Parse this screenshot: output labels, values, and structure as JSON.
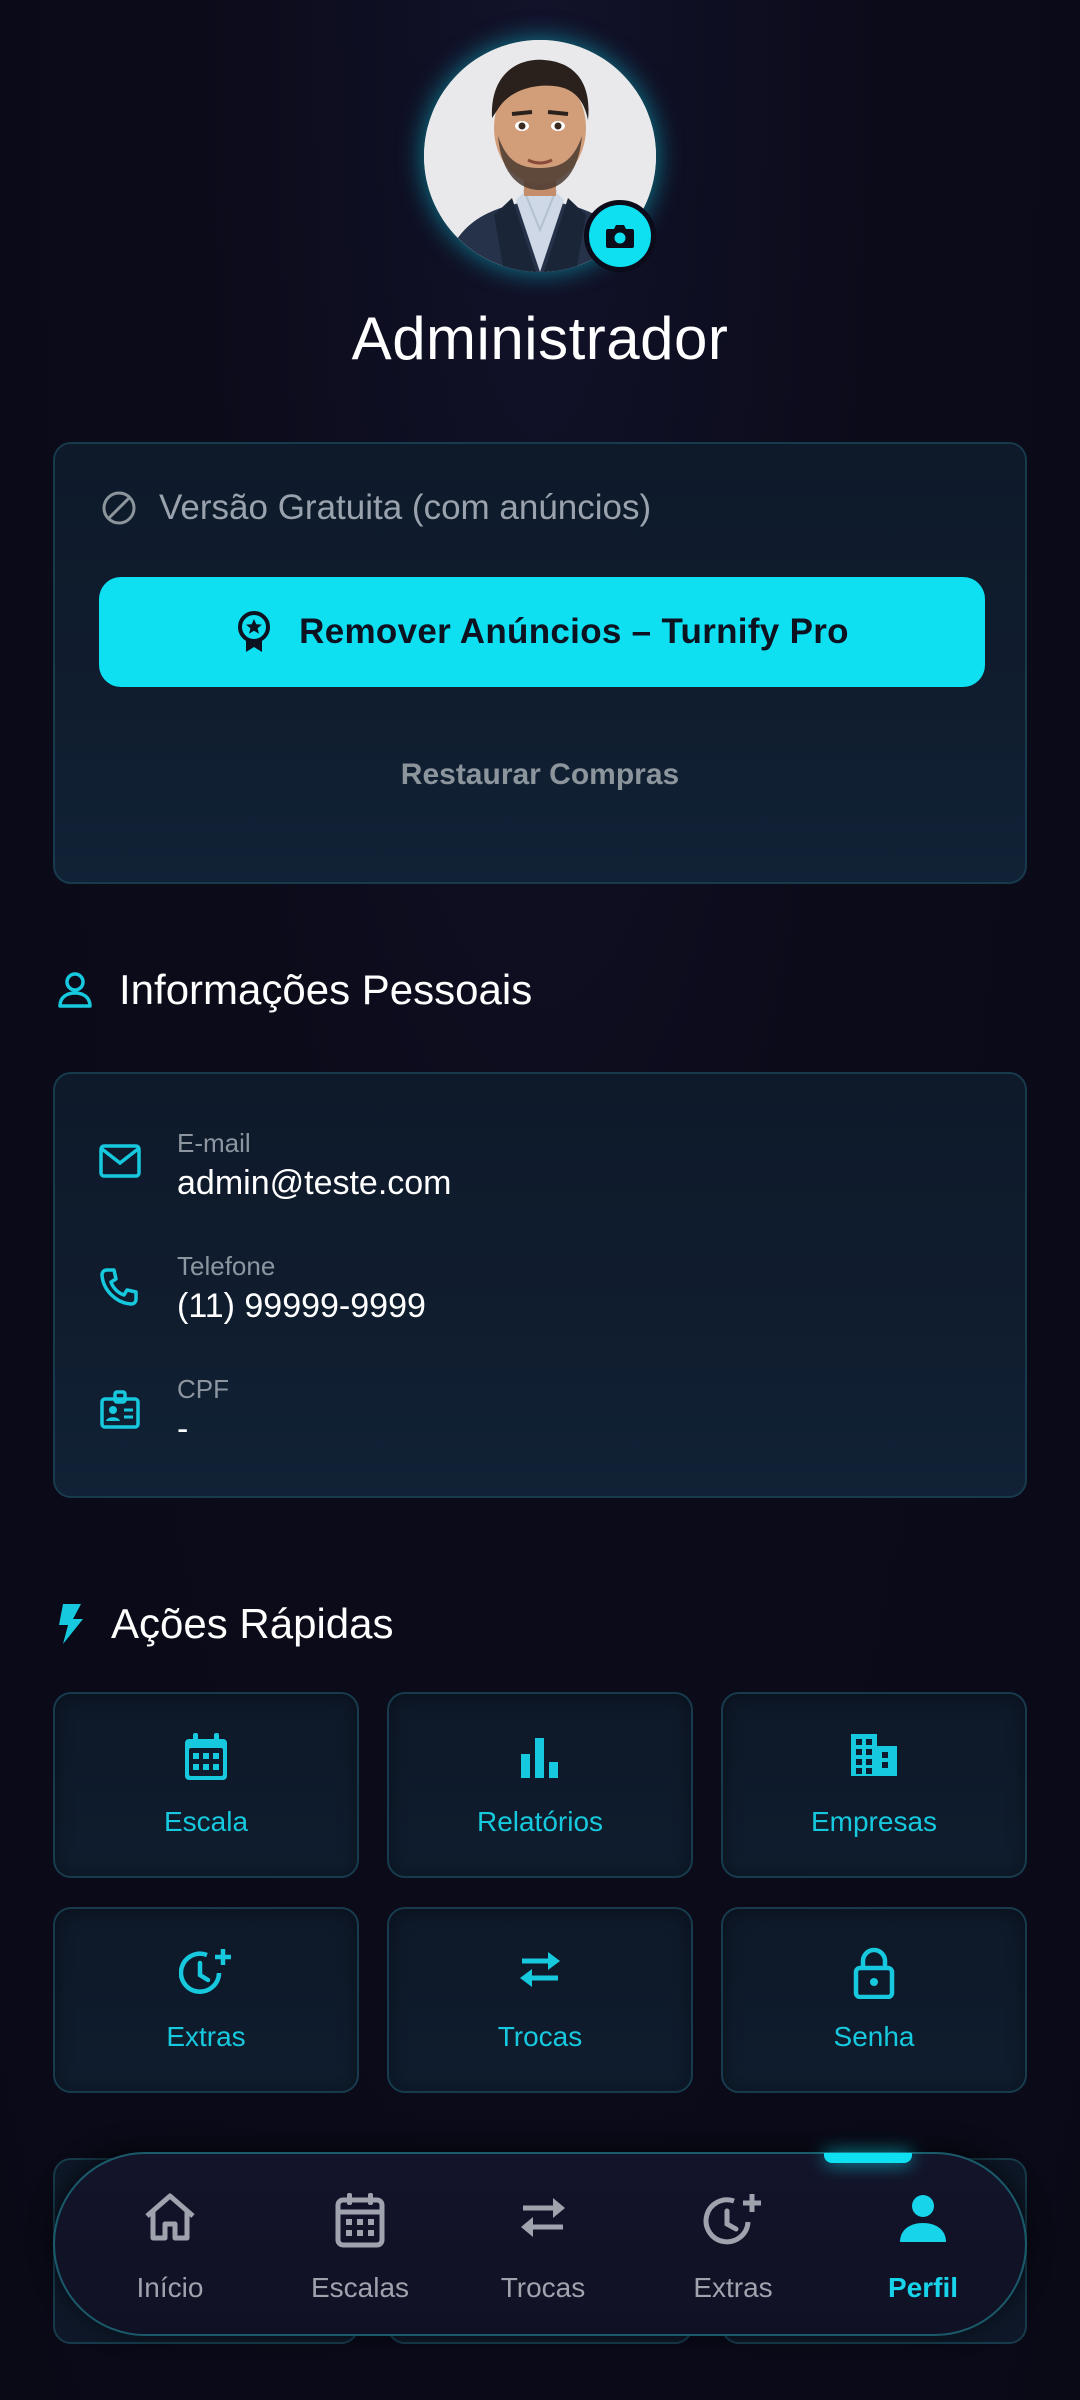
{
  "profile": {
    "name": "Administrador",
    "avatar_icon": "user-avatar-portrait",
    "camera_icon": "camera-icon"
  },
  "ads_card": {
    "status_label": "Versão Gratuita (com anúncios)",
    "pro_button_label": "Remover Anúncios – Turnify Pro",
    "restore_label": "Restaurar Compras"
  },
  "personal_info": {
    "title": "Informações Pessoais",
    "fields": [
      {
        "label": "E-mail",
        "value": "admin@teste.com",
        "icon": "mail-icon"
      },
      {
        "label": "Telefone",
        "value": "(11) 99999-9999",
        "icon": "phone-icon"
      },
      {
        "label": "CPF",
        "value": "-",
        "icon": "id-badge-icon"
      }
    ]
  },
  "quick_actions": {
    "title": "Ações Rápidas",
    "items": [
      {
        "label": "Escala",
        "icon": "calendar-icon"
      },
      {
        "label": "Relatórios",
        "icon": "bar-chart-icon"
      },
      {
        "label": "Empresas",
        "icon": "building-icon"
      },
      {
        "label": "Extras",
        "icon": "clock-plus-icon"
      },
      {
        "label": "Trocas",
        "icon": "swap-arrows-icon"
      },
      {
        "label": "Senha",
        "icon": "lock-icon"
      }
    ]
  },
  "bottom_nav": {
    "items": [
      {
        "label": "Início",
        "icon": "home-icon"
      },
      {
        "label": "Escalas",
        "icon": "calendar-icon"
      },
      {
        "label": "Trocas",
        "icon": "swap-arrows-icon"
      },
      {
        "label": "Extras",
        "icon": "clock-plus-icon"
      },
      {
        "label": "Perfil",
        "icon": "person-icon"
      }
    ],
    "active": "Perfil"
  },
  "colors": {
    "accent": "#0ee0f2",
    "background": "#0b0b1a",
    "card_border": "#173b4c",
    "muted_text": "#8d96a0"
  }
}
